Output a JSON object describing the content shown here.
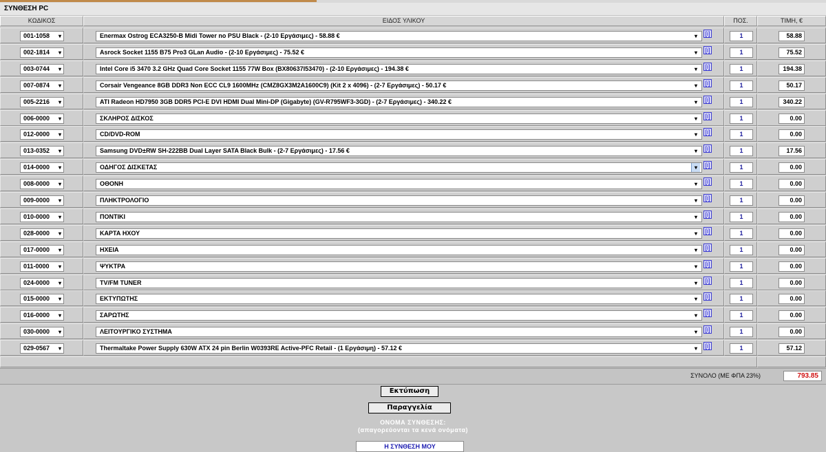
{
  "window": {
    "title": "ΣΥΝΘΕΣΗ PC"
  },
  "columns": {
    "code": "ΚΩΔΙΚΟΣ",
    "item": "ΕΙΔΟΣ ΥΛΙΚΟΥ",
    "qty": "ΠΟΣ.",
    "price": "ΤΙΜΗ, €"
  },
  "info_label": "[i]",
  "rows": [
    {
      "code": "001-1058",
      "item": "Enermax Ostrog ECA3250-B Midi Tower no PSU Black - (2-10 Εργάσιμες) - 58.88 €",
      "qty": "1",
      "price": "58.88"
    },
    {
      "code": "002-1814",
      "item": "Asrock Socket 1155 B75 Pro3 GLan Audio - (2-10 Εργάσιμες) - 75.52 €",
      "qty": "1",
      "price": "75.52"
    },
    {
      "code": "003-0744",
      "item": "Intel Core i5 3470 3.2 GHz Quad Core Socket 1155 77W Box (BX80637I53470) - (2-10 Εργάσιμες) - 194.38 €",
      "qty": "1",
      "price": "194.38"
    },
    {
      "code": "007-0874",
      "item": "Corsair Vengeance 8GB DDR3 Non ECC CL9 1600MHz (CMZ8GX3M2A1600C9) (Kit 2 x 4096) - (2-7 Εργάσιμες) - 50.17 €",
      "qty": "1",
      "price": "50.17"
    },
    {
      "code": "005-2216",
      "item": "ATI Radeon HD7950 3GB DDR5 PCI-E DVI HDMI Dual Mini-DP (Gigabyte) (GV-R795WF3-3GD) - (2-7 Εργάσιμες) - 340.22 €",
      "qty": "1",
      "price": "340.22"
    },
    {
      "code": "006-0000",
      "item": "ΣΚΛΗΡΟΣ ΔΙΣΚΟΣ",
      "qty": "1",
      "price": "0.00"
    },
    {
      "code": "012-0000",
      "item": "CD/DVD-ROM",
      "qty": "1",
      "price": "0.00"
    },
    {
      "code": "013-0352",
      "item": "Samsung DVD±RW SH-222BB Dual Layer SATA Black Bulk - (2-7 Εργάσιμες) - 17.56 €",
      "qty": "1",
      "price": "17.56"
    },
    {
      "code": "014-0000",
      "item": "ΟΔΗΓΟΣ ΔΙΣΚΕΤΑΣ",
      "qty": "1",
      "price": "0.00"
    },
    {
      "code": "008-0000",
      "item": "ΟΘΟΝΗ",
      "qty": "1",
      "price": "0.00"
    },
    {
      "code": "009-0000",
      "item": "ΠΛΗΚΤΡΟΛΟΓΙΟ",
      "qty": "1",
      "price": "0.00"
    },
    {
      "code": "010-0000",
      "item": "ΠΟΝΤΙΚΙ",
      "qty": "1",
      "price": "0.00"
    },
    {
      "code": "028-0000",
      "item": "ΚΑΡΤΑ ΗΧΟΥ",
      "qty": "1",
      "price": "0.00"
    },
    {
      "code": "017-0000",
      "item": "ΗΧΕΙΑ",
      "qty": "1",
      "price": "0.00"
    },
    {
      "code": "011-0000",
      "item": "ΨΥΚΤΡΑ",
      "qty": "1",
      "price": "0.00"
    },
    {
      "code": "024-0000",
      "item": "TV/FM TUNER",
      "qty": "1",
      "price": "0.00"
    },
    {
      "code": "015-0000",
      "item": "ΕΚΤΥΠΩΤΗΣ",
      "qty": "1",
      "price": "0.00"
    },
    {
      "code": "016-0000",
      "item": "ΣΑΡΩΤΗΣ",
      "qty": "1",
      "price": "0.00"
    },
    {
      "code": "030-0000",
      "item": "ΛΕΙΤΟΥΡΓΙΚΟ ΣΥΣΤΗΜΑ",
      "qty": "1",
      "price": "0.00"
    },
    {
      "code": "029-0567",
      "item": "Thermaltake Power Supply 630W ATX 24 pin Berlin W0393RE Active-PFC Retail - (1 Εργάσιμη) - 57.12 €",
      "qty": "1",
      "price": "57.12"
    }
  ],
  "totals": {
    "label": "ΣΥΝΟΛΟ (ΜΕ ΦΠΑ 23%)",
    "value": "793.85"
  },
  "actions": {
    "print_label": "Εκτύπωση",
    "order_label": "Παραγγελία"
  },
  "composition_name": {
    "title": "ΟΝΟΜΑ ΣΥΝΘΕΣΗΣ:",
    "hint": "(απαγορεύονται τα κενά ονόματα)",
    "value": "Η ΣΥΝΘΕΣΗ ΜΟΥ"
  },
  "colors": {
    "total_value": "#d01010",
    "info_icon": "#1a1ad6",
    "name_value": "#1a1ab0"
  }
}
